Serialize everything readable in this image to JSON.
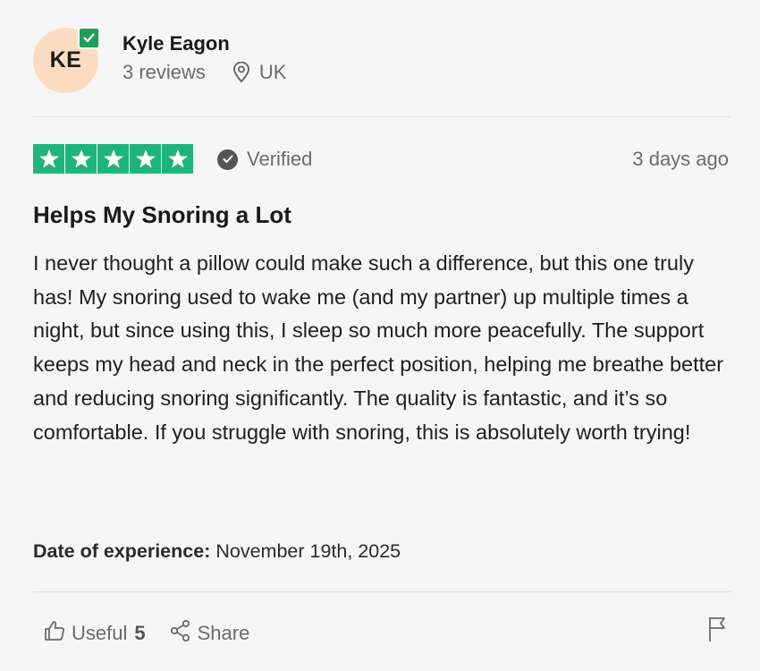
{
  "author": {
    "initials": "KE",
    "name": "Kyle Eagon",
    "reviews": "3 reviews",
    "location": "UK"
  },
  "review": {
    "rating": 5,
    "verified_label": "Verified",
    "posted": "3 days ago",
    "title": "Helps My Snoring a Lot",
    "body": "I never thought a pillow could make such a difference, but this one truly has! My snoring used to wake me (and my partner) up multiple times a night, but since using this, I sleep so much more peacefully. The support keeps my head and neck in the perfect position, helping me breathe better and reducing snoring significantly. The quality is fantastic, and it’s so comfortable. If you struggle with snoring, this is absolutely worth trying!",
    "experience_label": "Date of experience:",
    "experience_date": "November 19th, 2025"
  },
  "actions": {
    "useful_label": "Useful",
    "useful_count": "5",
    "share_label": "Share"
  },
  "colors": {
    "star_green": "#1fb57a",
    "badge_green": "#1f9e5a",
    "avatar_bg": "#fcdcc0"
  },
  "icons": [
    "verified-check-icon",
    "location-pin-icon",
    "star-icon",
    "verified-icon",
    "thumbs-up-icon",
    "share-icon",
    "flag-icon"
  ]
}
